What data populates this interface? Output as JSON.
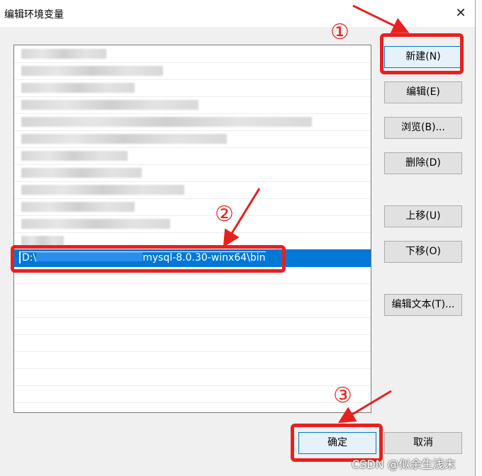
{
  "dialog": {
    "title": "编辑环境变量",
    "close_glyph": "✕"
  },
  "list": {
    "selected_text_prefix": "D:\\",
    "selected_text_suffix": "mysql-8.0.30-winx64\\bin"
  },
  "buttons": {
    "new": "新建(N)",
    "edit": "编辑(E)",
    "browse": "浏览(B)...",
    "delete": "删除(D)",
    "move_up": "上移(U)",
    "move_down": "下移(O)",
    "edit_text": "编辑文本(T)...",
    "ok": "确定",
    "cancel": "取消"
  },
  "annotations": {
    "step1": "①",
    "step2": "②",
    "step3": "③",
    "color": "#e8201e"
  },
  "watermark": "CSDN @似余生浅末"
}
